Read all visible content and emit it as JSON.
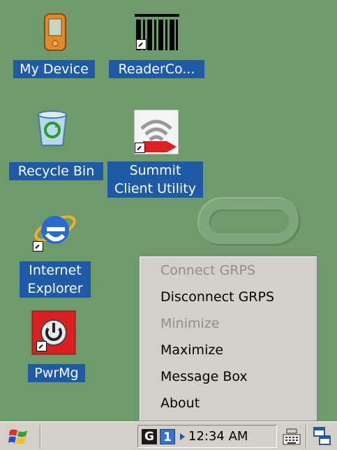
{
  "desktop": {
    "icons": [
      {
        "id": "my-device",
        "label": "My Device"
      },
      {
        "id": "readerco",
        "label": "ReaderCo..."
      },
      {
        "id": "recycle-bin",
        "label": "Recycle Bin"
      },
      {
        "id": "summit",
        "label_line1": "Summit",
        "label_line2": "Client Utility"
      },
      {
        "id": "ie",
        "label_line1": "Internet",
        "label_line2": "Explorer"
      },
      {
        "id": "pwrmg",
        "label": "PwrMg"
      }
    ]
  },
  "context_menu": {
    "items": [
      {
        "label": "Connect GRPS",
        "enabled": false
      },
      {
        "label": "Disconnect GRPS",
        "enabled": true
      },
      {
        "label": "Minimize",
        "enabled": false
      },
      {
        "label": "Maximize",
        "enabled": true
      },
      {
        "label": "Message Box",
        "enabled": true
      },
      {
        "label": "About",
        "enabled": true
      }
    ]
  },
  "taskbar": {
    "start_icon": "windows-flag-icon",
    "tray_g": "G",
    "tray_one": "1",
    "clock": "12:34 AM",
    "keyboard_icon": "keyboard-icon",
    "desktop_icon": "switch-windows-icon"
  },
  "colors": {
    "desktop_bg": "#6e9a6c",
    "selection": "#1e5aa6",
    "menu_bg": "#d4d0c8",
    "disabled_text": "#8e8e8e"
  }
}
